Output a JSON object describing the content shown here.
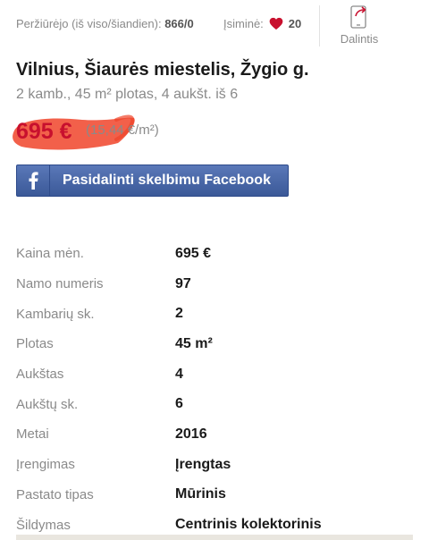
{
  "stats": {
    "views_label": "Peržiūrėjo (iš viso/šiandien):",
    "views_value": "866/0",
    "saved_label": "Įsiminė:",
    "saved_value": "20",
    "share_label": "Dalintis"
  },
  "listing": {
    "title": "Vilnius, Šiaurės miestelis, Žygio g.",
    "subtitle": "2 kamb., 45 m² plotas, 4 aukšt. iš 6",
    "price": "695 €",
    "price_per_sqm": "(15,44 €/m²)"
  },
  "facebook_button": {
    "label": "Pasidalinti skelbimu Facebook"
  },
  "details": [
    {
      "key": "Kaina mėn.",
      "value": "695 €"
    },
    {
      "key": "Namo numeris",
      "value": "97"
    },
    {
      "key": "Kambarių sk.",
      "value": "2"
    },
    {
      "key": "Plotas",
      "value": "45 m²"
    },
    {
      "key": "Aukštas",
      "value": "4"
    },
    {
      "key": "Aukštų sk.",
      "value": "6"
    },
    {
      "key": "Metai",
      "value": "2016"
    },
    {
      "key": "Įrengimas",
      "value": "Įrengtas"
    },
    {
      "key": "Pastato tipas",
      "value": "Mūrinis"
    },
    {
      "key": "Šildymas",
      "value": "Centrinis kolektorinis"
    }
  ],
  "colors": {
    "price_red": "#c8102e",
    "facebook_blue": "#3b5998",
    "highlight_smear": "#f0442a"
  },
  "icons": {
    "saved": "heart-icon",
    "share": "phone-share-icon",
    "facebook": "facebook-icon"
  }
}
